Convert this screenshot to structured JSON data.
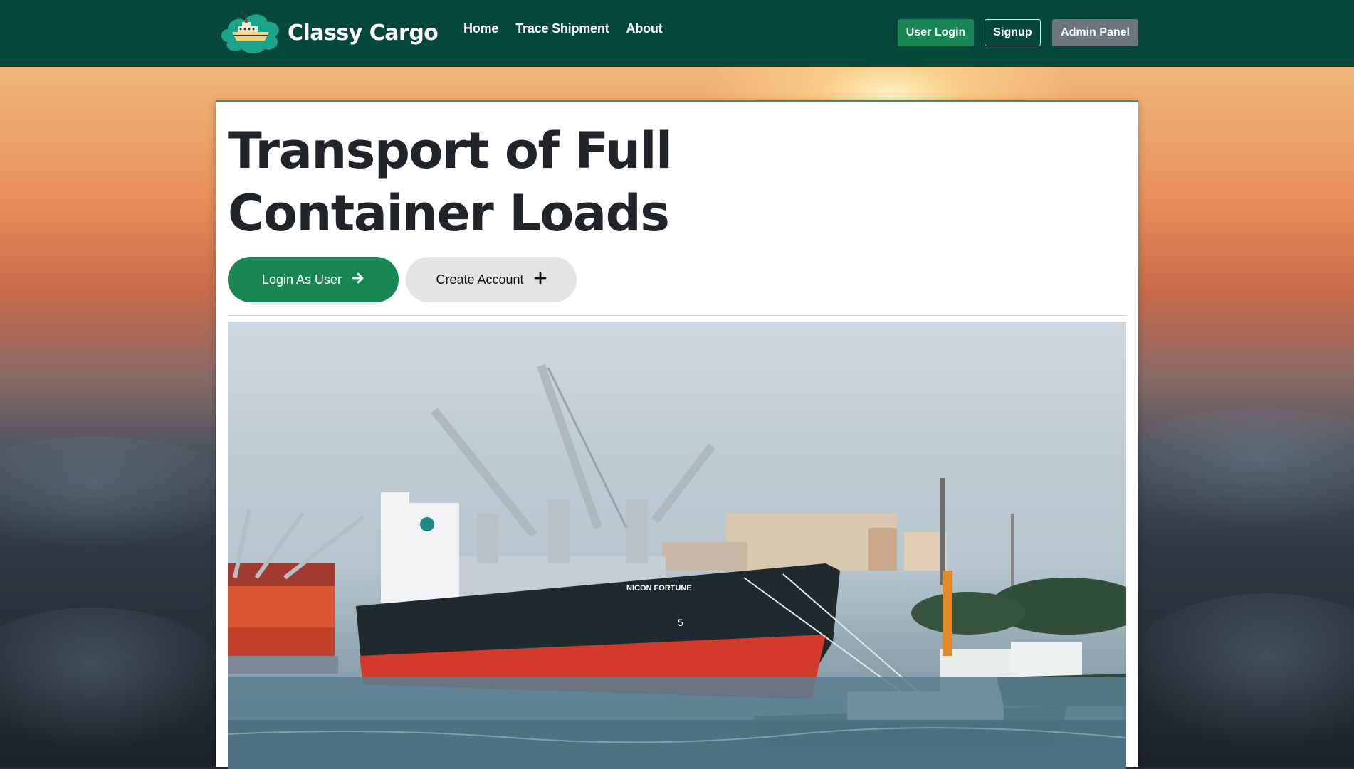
{
  "app": {
    "brand_name": "Classy Cargo",
    "logo_icon": "ship-icon",
    "colors": {
      "navbar": "#06473b",
      "primary_green": "#198754",
      "secondary_gray": "#6c757d",
      "card_accent": "#2e9e48"
    }
  },
  "nav": {
    "links": [
      {
        "label": "Home"
      },
      {
        "label": "Trace Shipment"
      },
      {
        "label": "About"
      }
    ],
    "user_login": "User Login",
    "signup": "Signup",
    "admin_panel": "Admin Panel"
  },
  "hero": {
    "title_line1": "Transport of Full",
    "title_line2": "Container Loads",
    "login_button": "Login As User",
    "login_icon": "arrow-right-icon",
    "create_button": "Create Account",
    "create_icon": "plus-icon"
  },
  "photo": {
    "ship_name": "NICON FORTUNE",
    "hull_mark": "5"
  }
}
